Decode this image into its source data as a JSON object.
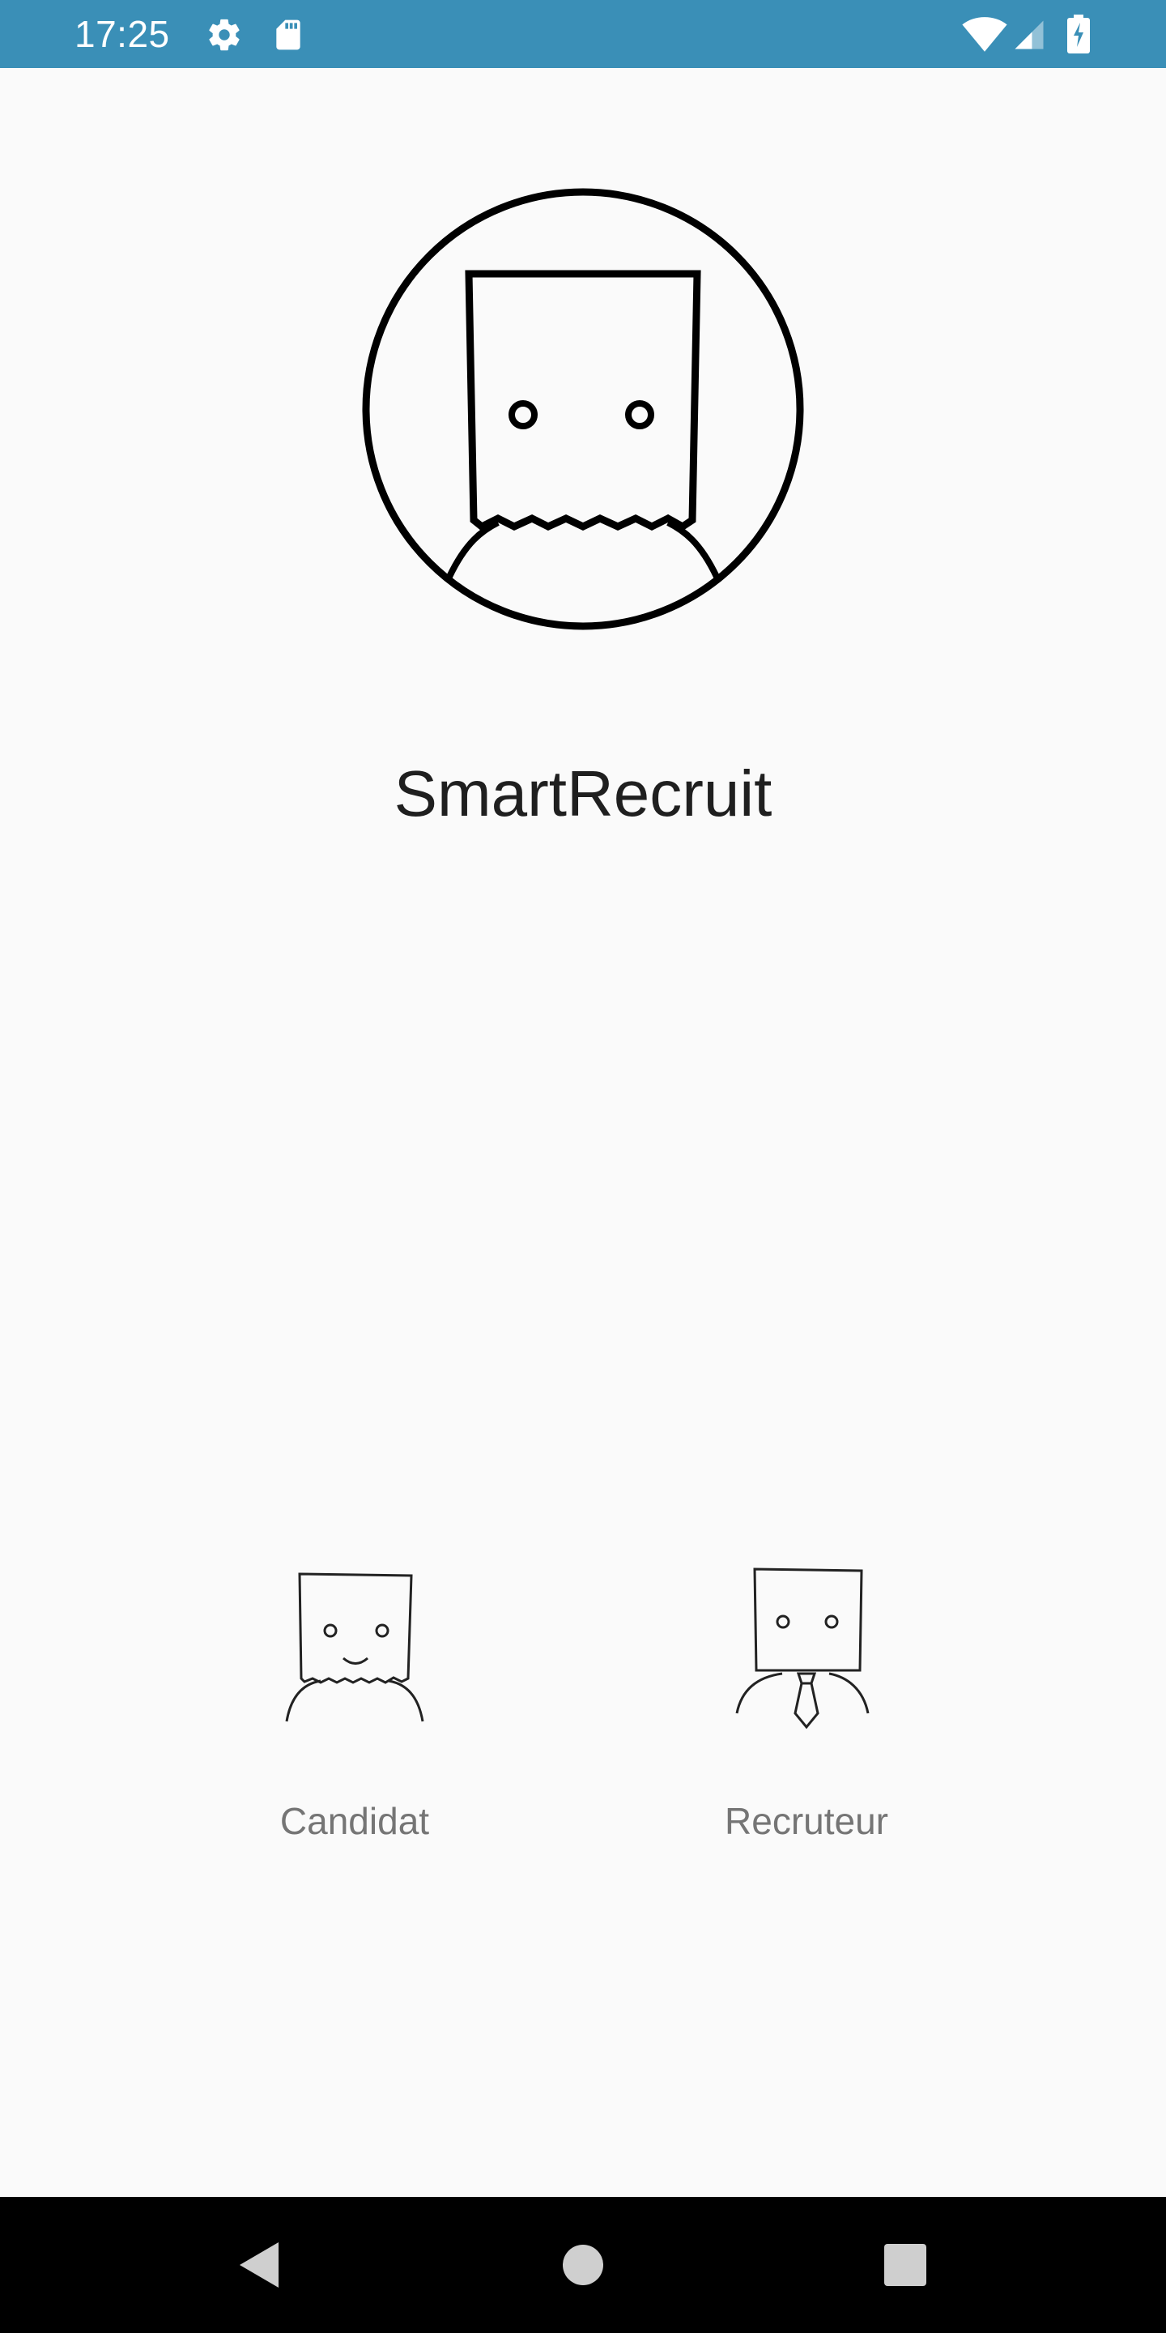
{
  "status_bar": {
    "time": "17:25",
    "icons": [
      "gear-icon",
      "sd-card-icon",
      "wifi-icon",
      "signal-icon",
      "battery-charging-icon"
    ],
    "background": "#3a8fb7"
  },
  "app": {
    "title": "SmartRecruit",
    "logo_icon": "paper-bag-head-icon"
  },
  "roles": [
    {
      "label": "Candidat",
      "icon": "candidate-icon"
    },
    {
      "label": "Recruteur",
      "icon": "recruiter-icon"
    }
  ],
  "nav_bar": {
    "buttons": [
      "back-icon",
      "home-icon",
      "recents-icon"
    ],
    "background": "#000000"
  }
}
